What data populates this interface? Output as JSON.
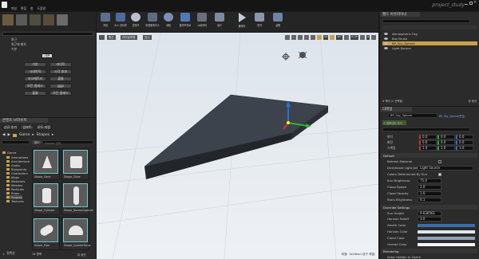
{
  "title": "project_study",
  "menus": [
    "파일",
    "편집",
    "창",
    "도움말"
  ],
  "modes": {
    "label_place": "배치",
    "label_paint": "",
    "label_landscape": "",
    "label_foliage": "",
    "label_geometry": ""
  },
  "modes_panel": {
    "search_placeholder": "",
    "opt1": "최근",
    "opt2": "최근에 배치",
    "opt3": "기본",
    "opt4": "라이트",
    "opt5": "시각 효과",
    "opt6": "BSP",
    "opt7": "볼륨",
    "opt8": "모든 클래스",
    "btn_a": "기본",
    "btn_b": "라이트",
    "btn_c": "시네마틱",
    "btn_d": "시각 효과",
    "btn_e": "지오메트리",
    "btn_f": "볼륨",
    "btn_g": "모든 클래스"
  },
  "toolbar": [
    {
      "label": "저장",
      "icon": "save-icon"
    },
    {
      "label": "소스 컨트롤",
      "icon": "source-control-icon"
    },
    {
      "label": "콘텐츠",
      "icon": "content-icon"
    },
    {
      "label": "마켓플레이스",
      "icon": "marketplace-icon"
    },
    {
      "label": "세팅",
      "icon": "settings-icon"
    },
    {
      "label": "블루프린트",
      "icon": "blueprint-icon"
    },
    {
      "label": "시네마틱",
      "icon": "cinematics-icon"
    },
    {
      "label": "빌드",
      "icon": "build-icon"
    },
    {
      "label": "플레이",
      "icon": "play-icon"
    },
    {
      "label": "런치",
      "icon": "launch-icon"
    },
    {
      "label": "실행",
      "icon": "run-icon"
    }
  ],
  "viewport": {
    "perspective": "원근",
    "lit": "라이팅포함",
    "show": "표시",
    "grid_snap": "10",
    "rot_snap": "10°",
    "scale_snap": "0.25",
    "cam_speed": "4",
    "level_label": "레벨:",
    "level_name": "Untitled (영구 레벨)"
  },
  "content_browser": {
    "title": "콘텐츠 브라우저",
    "add_new": "신규 추가",
    "import": "임포트",
    "save_all": "모두 저장",
    "path": [
      "Game",
      "Shapes"
    ],
    "search_folders": "폴더 검색",
    "filters": "필터",
    "search_assets": "Shapes 검색",
    "folders": [
      "Content",
      "Game",
      "Animations",
      "Architecture",
      "Audio",
      "Blueprints",
      "Characters",
      "Maps",
      "Materials",
      "Meshes",
      "Particles",
      "Props",
      "Shapes",
      "Textures"
    ],
    "assets": [
      "Shape_Cone",
      "Shape_Cube",
      "Shape_Cylinder",
      "Shape_NarrowCapsule",
      "Shape_Pipe",
      "Shape_QuarterTorus"
    ],
    "count": "19 항목",
    "view_options": "뷰 옵션",
    "collections": "컬렉션"
  },
  "outliner": {
    "title": "월드 아웃라이너",
    "search_placeholder": "검색",
    "items": [
      {
        "label": "Atmospheric Fog",
        "selected": false
      },
      {
        "label": "Box Brush",
        "selected": false
      },
      {
        "label": "BP_Sky_Sphere",
        "selected": true
      },
      {
        "label": "Light Source",
        "selected": false
      }
    ],
    "footer": "4 액터 (1 선택됨)",
    "view_options": "뷰 옵션"
  },
  "details": {
    "title": "디테일",
    "actor_name": "BP_Sky_Sphere",
    "edit_bp": "BP_Sky_Sphere(편집)",
    "add_component": "+ 컴포넌트 추가",
    "search_placeholder": "디테일 검색",
    "transform": {
      "location_label": "위치",
      "location": [
        "0.0",
        "0.0",
        "0.0"
      ],
      "rotation_label": "회전",
      "rotation": [
        "0.0",
        "0.0",
        "0.0"
      ],
      "scale_label": "스케일",
      "scale": [
        "1.0",
        "1.0",
        "1.0"
      ]
    },
    "default_section": "Default",
    "props": [
      {
        "label": "Refresh Material",
        "value": ""
      },
      {
        "label": "Directional Light Actor",
        "value": "Light Source"
      },
      {
        "label": "Colors Determined By Sun",
        "value": ""
      },
      {
        "label": "Sun Brightness",
        "value": "75.0"
      },
      {
        "label": "Cloud Speed",
        "value": "2.0"
      },
      {
        "label": "Cloud Opacity",
        "value": "1.0"
      },
      {
        "label": "Stars Brightness",
        "value": "0.1"
      }
    ],
    "override_section": "Override Settings",
    "override_props": [
      {
        "label": "Sun Height",
        "value": "0.630561"
      },
      {
        "label": "Horizon Falloff",
        "value": "3.0"
      },
      {
        "label": "Zenith Color",
        "value": ""
      },
      {
        "label": "Horizon Color",
        "value": ""
      },
      {
        "label": "Cloud Color",
        "value": ""
      },
      {
        "label": "Overall Color",
        "value": ""
      }
    ],
    "rendering_section": "Rendering",
    "rendering_prop": "Actor Hidden In Game"
  },
  "colors": {
    "accent": "#c9a24d",
    "selection": "#c9a24d",
    "viewport_sky": "#e6eaee"
  }
}
